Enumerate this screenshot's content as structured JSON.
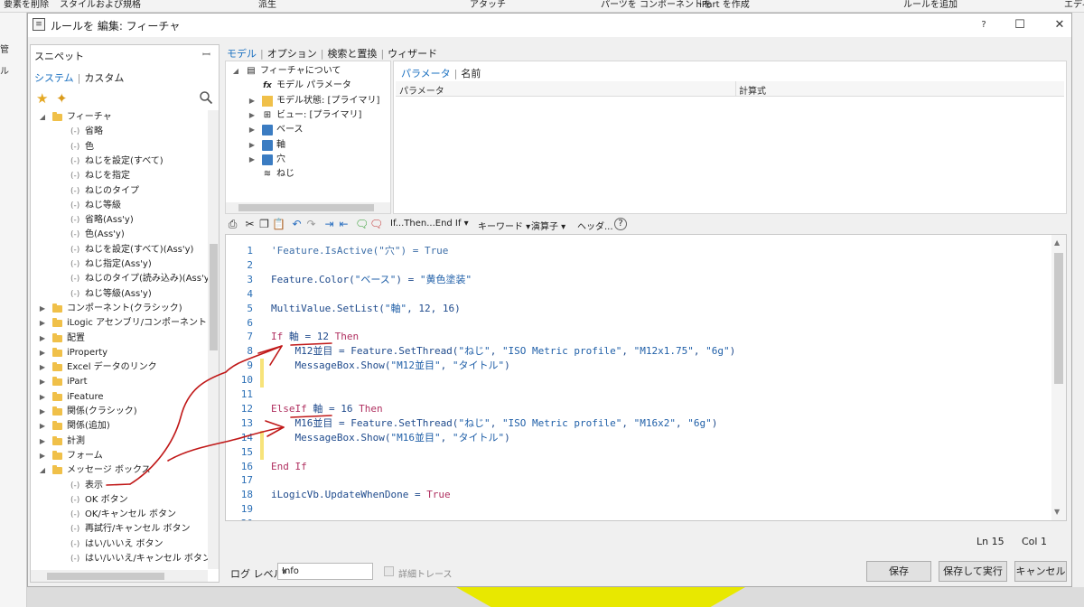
{
  "background": {
    "ribbon_items": [
      "要素を削除",
      "スタイルおよび規格",
      "派生",
      "アタッチ",
      "パーツを コンポーネントを",
      "iPart を作成",
      "ルールを追加",
      "エディ"
    ],
    "left_strip_items": [
      "管",
      "ル"
    ]
  },
  "dialog": {
    "title": "ルールを 編集: フィーチャ",
    "help_label": "?",
    "maximize_label": "☐",
    "close_label": "✕"
  },
  "snippets": {
    "header": "スニペット",
    "pin_glyph": "ꟷ",
    "tabs": [
      "システム",
      "カスタム"
    ],
    "tree": [
      {
        "label": "フィーチャ",
        "kind": "folder",
        "expanded": true,
        "level": 0
      },
      {
        "label": "省略",
        "kind": "leaf",
        "level": 1
      },
      {
        "label": "色",
        "kind": "leaf",
        "level": 1
      },
      {
        "label": "ねじを設定(すべて)",
        "kind": "leaf",
        "level": 1
      },
      {
        "label": "ねじを指定",
        "kind": "leaf",
        "level": 1
      },
      {
        "label": "ねじのタイプ",
        "kind": "leaf",
        "level": 1
      },
      {
        "label": "ねじ等級",
        "kind": "leaf",
        "level": 1
      },
      {
        "label": "省略(Ass'y)",
        "kind": "leaf",
        "level": 1
      },
      {
        "label": "色(Ass'y)",
        "kind": "leaf",
        "level": 1
      },
      {
        "label": "ねじを設定(すべて)(Ass'y)",
        "kind": "leaf",
        "level": 1
      },
      {
        "label": "ねじ指定(Ass'y)",
        "kind": "leaf",
        "level": 1
      },
      {
        "label": "ねじのタイプ(読み込み)(Ass'y)",
        "kind": "leaf",
        "level": 1
      },
      {
        "label": "ねじ等級(Ass'y)",
        "kind": "leaf",
        "level": 1
      },
      {
        "label": "コンポーネント(クラシック)",
        "kind": "folder",
        "expanded": false,
        "level": 0
      },
      {
        "label": "iLogic アセンブリ/コンポーネント",
        "kind": "folder",
        "expanded": false,
        "level": 0
      },
      {
        "label": "配置",
        "kind": "folder",
        "expanded": false,
        "level": 0
      },
      {
        "label": "iProperty",
        "kind": "folder",
        "expanded": false,
        "level": 0
      },
      {
        "label": "Excel データのリンク",
        "kind": "folder",
        "expanded": false,
        "level": 0
      },
      {
        "label": "iPart",
        "kind": "folder",
        "expanded": false,
        "level": 0
      },
      {
        "label": "iFeature",
        "kind": "folder",
        "expanded": false,
        "level": 0
      },
      {
        "label": "関係(クラシック)",
        "kind": "folder",
        "expanded": false,
        "level": 0
      },
      {
        "label": "関係(追加)",
        "kind": "folder",
        "expanded": false,
        "level": 0
      },
      {
        "label": "計測",
        "kind": "folder",
        "expanded": false,
        "level": 0
      },
      {
        "label": "フォーム",
        "kind": "folder",
        "expanded": false,
        "level": 0
      },
      {
        "label": "メッセージ ボックス",
        "kind": "folder",
        "expanded": true,
        "level": 0
      },
      {
        "label": "表示",
        "kind": "leaf",
        "level": 1
      },
      {
        "label": "OK ボタン",
        "kind": "leaf",
        "level": 1
      },
      {
        "label": "OK/キャンセル ボタン",
        "kind": "leaf",
        "level": 1
      },
      {
        "label": "再試行/キャンセル ボタン",
        "kind": "leaf",
        "level": 1
      },
      {
        "label": "はい/いいえ ボタン",
        "kind": "leaf",
        "level": 1
      },
      {
        "label": "はい/いいえ/キャンセル ボタン",
        "kind": "leaf",
        "level": 1
      }
    ]
  },
  "main_tabs": [
    "モデル",
    "オプション",
    "検索と置換",
    "ウィザード"
  ],
  "model_tree": [
    {
      "label": "フィーチャについて",
      "icon": "document-icon",
      "glyph": "▤",
      "expanded": true,
      "level": 0
    },
    {
      "label": "モデル パラメータ",
      "icon": "fx-icon",
      "glyph": "fx",
      "expanded": null,
      "level": 1
    },
    {
      "label": "モデル状態: [プライマリ]",
      "icon": "folder-icon",
      "glyph": "",
      "expanded": false,
      "level": 1
    },
    {
      "label": "ビュー: [プライマリ]",
      "icon": "view-icon",
      "glyph": "⊞",
      "expanded": false,
      "level": 1
    },
    {
      "label": "ベース",
      "icon": "part-icon",
      "glyph": "",
      "expanded": false,
      "level": 1
    },
    {
      "label": "軸",
      "icon": "part-icon",
      "glyph": "",
      "expanded": false,
      "level": 1
    },
    {
      "label": "穴",
      "icon": "part-icon",
      "glyph": "",
      "expanded": false,
      "level": 1
    },
    {
      "label": "ねじ",
      "icon": "thread-icon",
      "glyph": "≋",
      "expanded": null,
      "level": 1
    }
  ],
  "parameters": {
    "tabs": [
      "パラメータ",
      "名前"
    ],
    "columns": [
      "パラメータ",
      "計算式"
    ]
  },
  "editor_toolbar": {
    "if_then_label": "If...Then...End If",
    "keyword_label": "キーワード",
    "operator_label": "演算子",
    "header_label": "ヘッダ...",
    "help_glyph": "?"
  },
  "code_lines": [
    [
      {
        "t": "'Feature.IsActive(\"穴\") = True",
        "c": "c"
      }
    ],
    [],
    [
      {
        "t": "Feature.Color(",
        "c": ""
      },
      {
        "t": "\"ベース\"",
        "c": "s"
      },
      {
        "t": ") = ",
        "c": ""
      },
      {
        "t": "\"黄色塗装\"",
        "c": "s"
      }
    ],
    [],
    [
      {
        "t": "MultiValue.SetList(",
        "c": ""
      },
      {
        "t": "\"軸\"",
        "c": "s"
      },
      {
        "t": ", 12, 16)",
        "c": ""
      }
    ],
    [],
    [
      {
        "t": "If",
        "c": "k"
      },
      {
        "t": " 軸 = 12 ",
        "c": ""
      },
      {
        "t": "Then",
        "c": "k"
      }
    ],
    [
      {
        "t": "    M12並目 = Feature.SetThread(",
        "c": ""
      },
      {
        "t": "\"ねじ\"",
        "c": "s"
      },
      {
        "t": ", ",
        "c": ""
      },
      {
        "t": "\"ISO Metric profile\"",
        "c": "s"
      },
      {
        "t": ", ",
        "c": ""
      },
      {
        "t": "\"M12x1.75\"",
        "c": "s"
      },
      {
        "t": ", ",
        "c": ""
      },
      {
        "t": "\"6g\"",
        "c": "s"
      },
      {
        "t": ")",
        "c": ""
      }
    ],
    [
      {
        "t": "    MessageBox.Show(",
        "c": ""
      },
      {
        "t": "\"M12並目\"",
        "c": "s"
      },
      {
        "t": ", ",
        "c": ""
      },
      {
        "t": "\"タイトル\"",
        "c": "s"
      },
      {
        "t": ")",
        "c": ""
      }
    ],
    [],
    [],
    [
      {
        "t": "ElseIf",
        "c": "k"
      },
      {
        "t": " 軸 = 16 ",
        "c": ""
      },
      {
        "t": "Then",
        "c": "k"
      }
    ],
    [
      {
        "t": "    M16並目 = Feature.SetThread(",
        "c": ""
      },
      {
        "t": "\"ねじ\"",
        "c": "s"
      },
      {
        "t": ", ",
        "c": ""
      },
      {
        "t": "\"ISO Metric profile\"",
        "c": "s"
      },
      {
        "t": ", ",
        "c": ""
      },
      {
        "t": "\"M16x2\"",
        "c": "s"
      },
      {
        "t": ", ",
        "c": ""
      },
      {
        "t": "\"6g\"",
        "c": "s"
      },
      {
        "t": ")",
        "c": ""
      }
    ],
    [
      {
        "t": "    MessageBox.Show(",
        "c": ""
      },
      {
        "t": "\"M16並目\"",
        "c": "s"
      },
      {
        "t": ", ",
        "c": ""
      },
      {
        "t": "\"タイトル\"",
        "c": "s"
      },
      {
        "t": ")",
        "c": ""
      }
    ],
    [],
    [
      {
        "t": "End If",
        "c": "k"
      }
    ],
    [],
    [
      {
        "t": "iLogicVb.UpdateWhenDone = ",
        "c": ""
      },
      {
        "t": "True",
        "c": "k"
      }
    ],
    [],
    []
  ],
  "modified_lines": [
    9,
    10,
    14,
    15
  ],
  "status": {
    "line": "Ln 15",
    "column": "Col 1"
  },
  "bottom": {
    "log_level_label": "ログ レベル",
    "log_level_value": "Info",
    "trace_label": "詳細トレース",
    "save_label": "保存",
    "save_run_label": "保存して実行",
    "cancel_label": "キャンセル"
  },
  "colors": {
    "accent": "#1a70c0",
    "keyword": "#b03060",
    "string": "#1f5fa8",
    "annotation_ink": "#c01818",
    "modified_marker": "#f7e37a"
  }
}
